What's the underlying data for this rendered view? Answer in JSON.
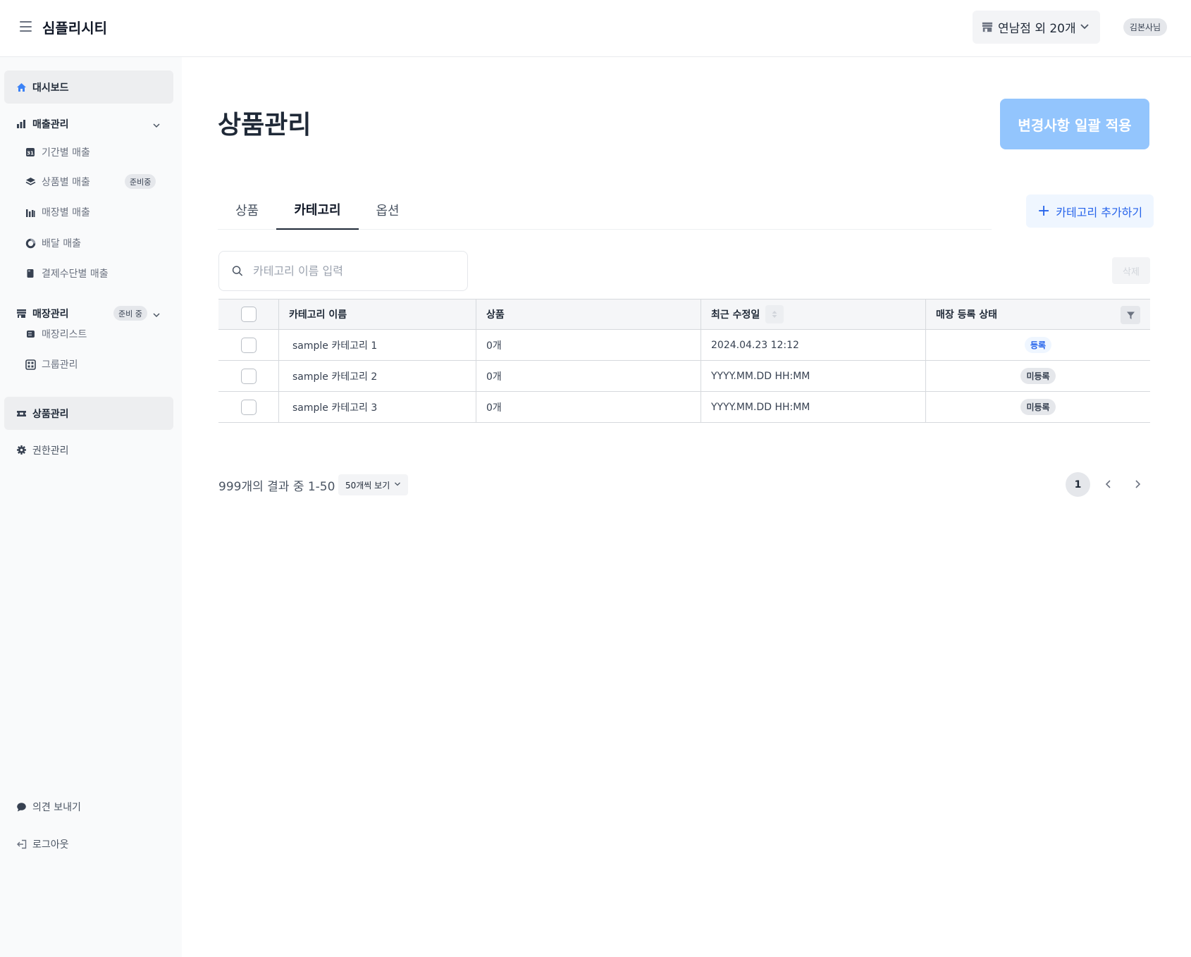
{
  "header": {
    "app_title": "심플리시티",
    "store_selector": "연남점 외 20개",
    "user": "김본사님"
  },
  "sidebar": {
    "dashboard": "대시보드",
    "sales": {
      "label": "매출관리",
      "items": [
        {
          "label": "기간별 매출",
          "icon": "calendar-icon"
        },
        {
          "label": "상품별 매출",
          "icon": "layers-icon",
          "badge": "준비중"
        },
        {
          "label": "매장별 매출",
          "icon": "bars-icon"
        },
        {
          "label": "배달 매출",
          "icon": "donut-icon"
        },
        {
          "label": "결제수단별 매출",
          "icon": "card-icon"
        }
      ]
    },
    "stores": {
      "label": "매장관리",
      "badge": "준비 중",
      "items": [
        {
          "label": "매장리스트",
          "icon": "store-list-icon"
        },
        {
          "label": "그룹관리",
          "icon": "group-icon"
        }
      ]
    },
    "products": "상품관리",
    "permissions": "권한관리",
    "feedback": "의견 보내기",
    "logout": "로그아웃"
  },
  "main": {
    "title": "상품관리",
    "apply_button": "변경사항 일괄 적용",
    "tabs": [
      {
        "label": "상품",
        "active": false
      },
      {
        "label": "카테고리",
        "active": true
      },
      {
        "label": "옵션",
        "active": false
      }
    ],
    "add_category_button": "카테고리 추가하기",
    "search_placeholder": "카테고리 이름 입력",
    "delete_button": "삭제",
    "table": {
      "columns": [
        "카테고리 이름",
        "상품",
        "최근 수정일",
        "매장 등록 상태"
      ],
      "rows": [
        {
          "name": "sample 카테고리 1",
          "products": "0개",
          "updated": "2024.04.23 12:12",
          "status": "등록",
          "registered": true
        },
        {
          "name": "sample 카테고리 2",
          "products": "0개",
          "updated": "YYYY.MM.DD HH:MM",
          "status": "미등록",
          "registered": false
        },
        {
          "name": "sample 카테고리 3",
          "products": "0개",
          "updated": "YYYY.MM.DD HH:MM",
          "status": "미등록",
          "registered": false
        }
      ]
    },
    "pagination": {
      "result_text": "999개의 결과 중 1-50",
      "per_page": "50개씩 보기",
      "current_page": "1"
    }
  },
  "colors": {
    "accent": "#2563eb",
    "apply_button_bg": "#93c5fd",
    "sidebar_bg": "#f9fafb"
  }
}
